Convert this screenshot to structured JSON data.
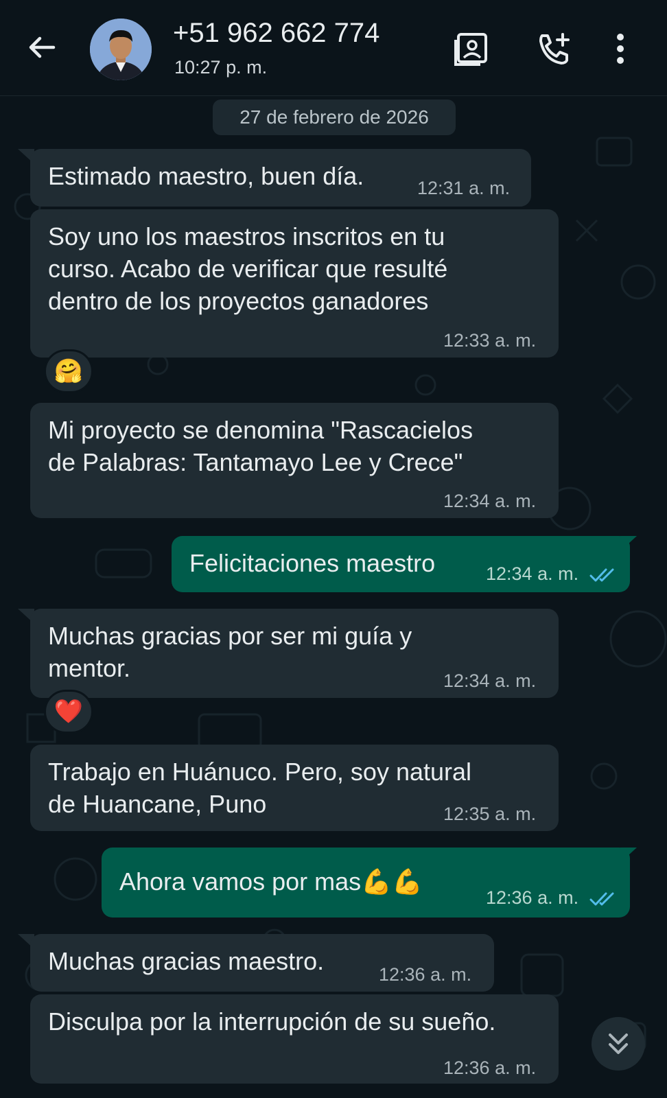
{
  "header": {
    "contact_name": "+51 962 662 774",
    "status": "10:27 p. m.",
    "icons": [
      "back-arrow-icon",
      "contact-card-icon",
      "add-call-icon",
      "more-vert-icon"
    ]
  },
  "chat": {
    "date_label": "27 de febrero de 2026",
    "messages": [
      {
        "dir": "in",
        "lines": [
          "Estimado maestro, buen día."
        ],
        "time": "12:31 a. m."
      },
      {
        "dir": "in",
        "lines": [
          "Soy uno los maestros inscritos en tu",
          "curso. Acabo de verificar que resulté",
          "dentro de los proyectos ganadores"
        ],
        "time": "12:33 a. m.",
        "reaction": "🤗"
      },
      {
        "dir": "in",
        "lines": [
          "Mi proyecto se denomina \"Rascacielos",
          "de Palabras: Tantamayo Lee y Crece\""
        ],
        "time": "12:34 a. m."
      },
      {
        "dir": "out",
        "lines": [
          "Felicitaciones maestro"
        ],
        "time": "12:34 a. m.",
        "read": true
      },
      {
        "dir": "in",
        "lines": [
          "Muchas gracias por ser mi guía y",
          "mentor."
        ],
        "time": "12:34 a. m.",
        "reaction": "❤️"
      },
      {
        "dir": "in",
        "lines": [
          "Trabajo en Huánuco. Pero, soy natural",
          "de Huancane, Puno"
        ],
        "time": "12:35 a. m."
      },
      {
        "dir": "out",
        "lines": [
          "Ahora vamos por mas💪💪"
        ],
        "time": "12:36 a. m.",
        "read": true
      },
      {
        "dir": "in",
        "lines": [
          "Muchas gracias maestro."
        ],
        "time": "12:36 a. m."
      },
      {
        "dir": "in",
        "lines": [
          "Disculpa por la interrupción de su sueño."
        ],
        "time": "12:36 a. m."
      }
    ]
  },
  "colors": {
    "background": "#0b141a",
    "incoming_bubble": "#202c33",
    "outgoing_bubble": "#005c4b",
    "read_ticks": "#53bdeb"
  }
}
